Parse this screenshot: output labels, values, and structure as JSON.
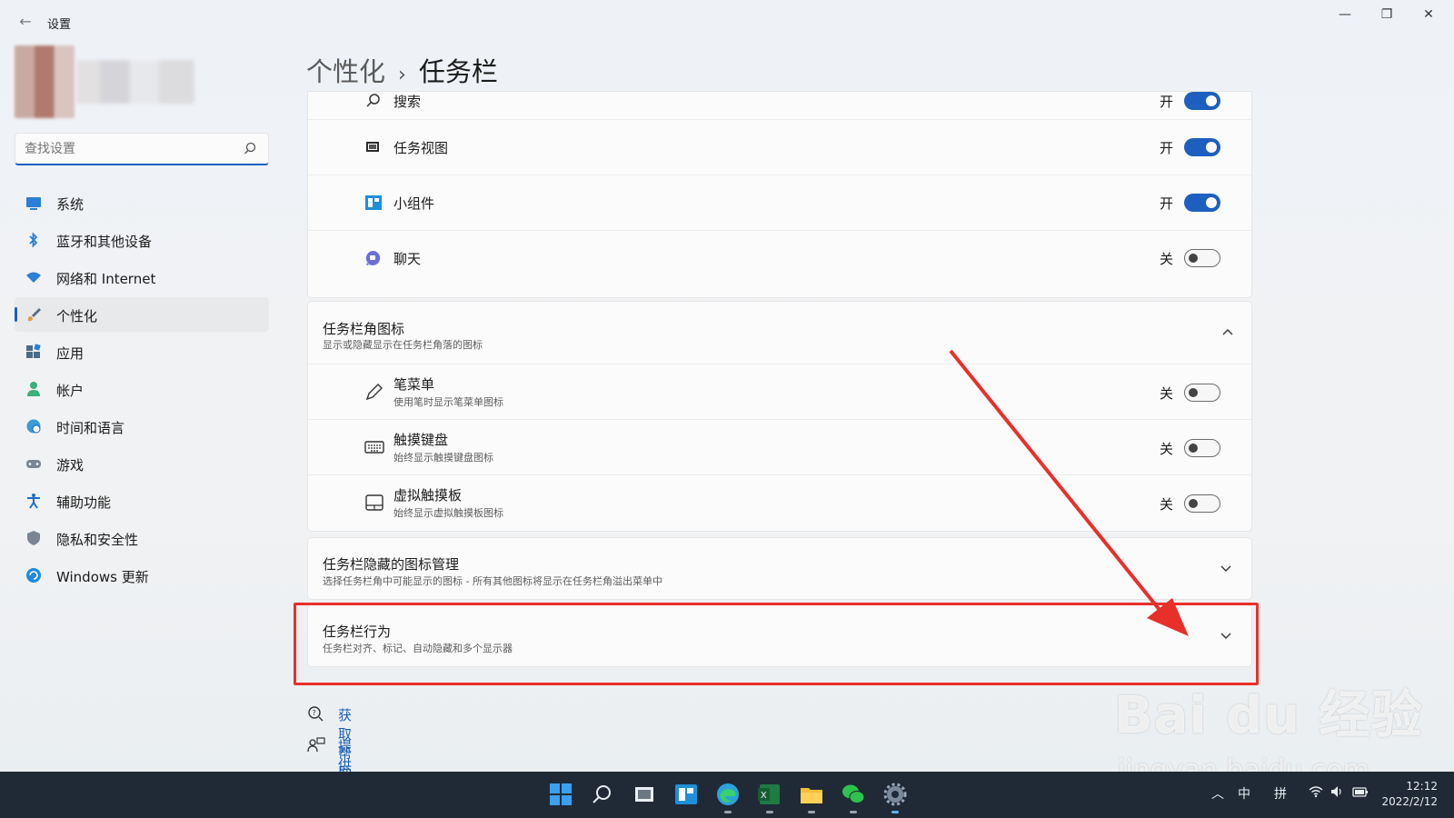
{
  "window": {
    "title": "设置"
  },
  "search": {
    "placeholder": "查找设置"
  },
  "nav": [
    {
      "label": "系统",
      "icon": "system-icon"
    },
    {
      "label": "蓝牙和其他设备",
      "icon": "bluetooth-icon"
    },
    {
      "label": "网络和 Internet",
      "icon": "wifi-icon"
    },
    {
      "label": "个性化",
      "icon": "brush-icon",
      "selected": true
    },
    {
      "label": "应用",
      "icon": "apps-icon"
    },
    {
      "label": "帐户",
      "icon": "account-icon"
    },
    {
      "label": "时间和语言",
      "icon": "globe-clock-icon"
    },
    {
      "label": "游戏",
      "icon": "gamepad-icon"
    },
    {
      "label": "辅助功能",
      "icon": "accessibility-icon"
    },
    {
      "label": "隐私和安全性",
      "icon": "shield-icon"
    },
    {
      "label": "Windows 更新",
      "icon": "update-icon"
    }
  ],
  "breadcrumb": {
    "parent": "个性化",
    "separator": "›",
    "current": "任务栏"
  },
  "taskbar_items": {
    "rows": [
      {
        "label": "搜索",
        "state": "开",
        "on": true,
        "icon": "search-icon"
      },
      {
        "label": "任务视图",
        "state": "开",
        "on": true,
        "icon": "task-view-icon"
      },
      {
        "label": "小组件",
        "state": "开",
        "on": true,
        "icon": "widgets-icon"
      },
      {
        "label": "聊天",
        "state": "关",
        "on": false,
        "icon": "chat-icon"
      }
    ]
  },
  "corner_icons": {
    "title": "任务栏角图标",
    "subtitle": "显示或隐藏显示在任务栏角落的图标",
    "rows": [
      {
        "label": "笔菜单",
        "sub": "使用笔时显示笔菜单图标",
        "state": "关",
        "on": false,
        "icon": "pen-icon"
      },
      {
        "label": "触摸键盘",
        "sub": "始终显示触摸键盘图标",
        "state": "关",
        "on": false,
        "icon": "keyboard-icon"
      },
      {
        "label": "虚拟触摸板",
        "sub": "始终显示虚拟触摸板图标",
        "state": "关",
        "on": false,
        "icon": "touchpad-icon"
      }
    ]
  },
  "overflow": {
    "title": "任务栏隐藏的图标管理",
    "subtitle": "选择任务栏角中可能显示的图标 - 所有其他图标将显示在任务栏角溢出菜单中"
  },
  "behaviors": {
    "title": "任务栏行为",
    "subtitle": "任务栏对齐、标记、自动隐藏和多个显示器"
  },
  "help": {
    "get_help": "获取帮助",
    "feedback": "提供反馈"
  },
  "watermark": {
    "brand": "Bai du 经验",
    "url": "jingyan.baidu.com"
  },
  "system_tray": {
    "ime_mode": "中",
    "ime_pinyin": "拼",
    "time": "12:12",
    "date": "2022/2/12"
  },
  "colors": {
    "accent": "#1d5fbf",
    "highlight": "#e8302a"
  }
}
